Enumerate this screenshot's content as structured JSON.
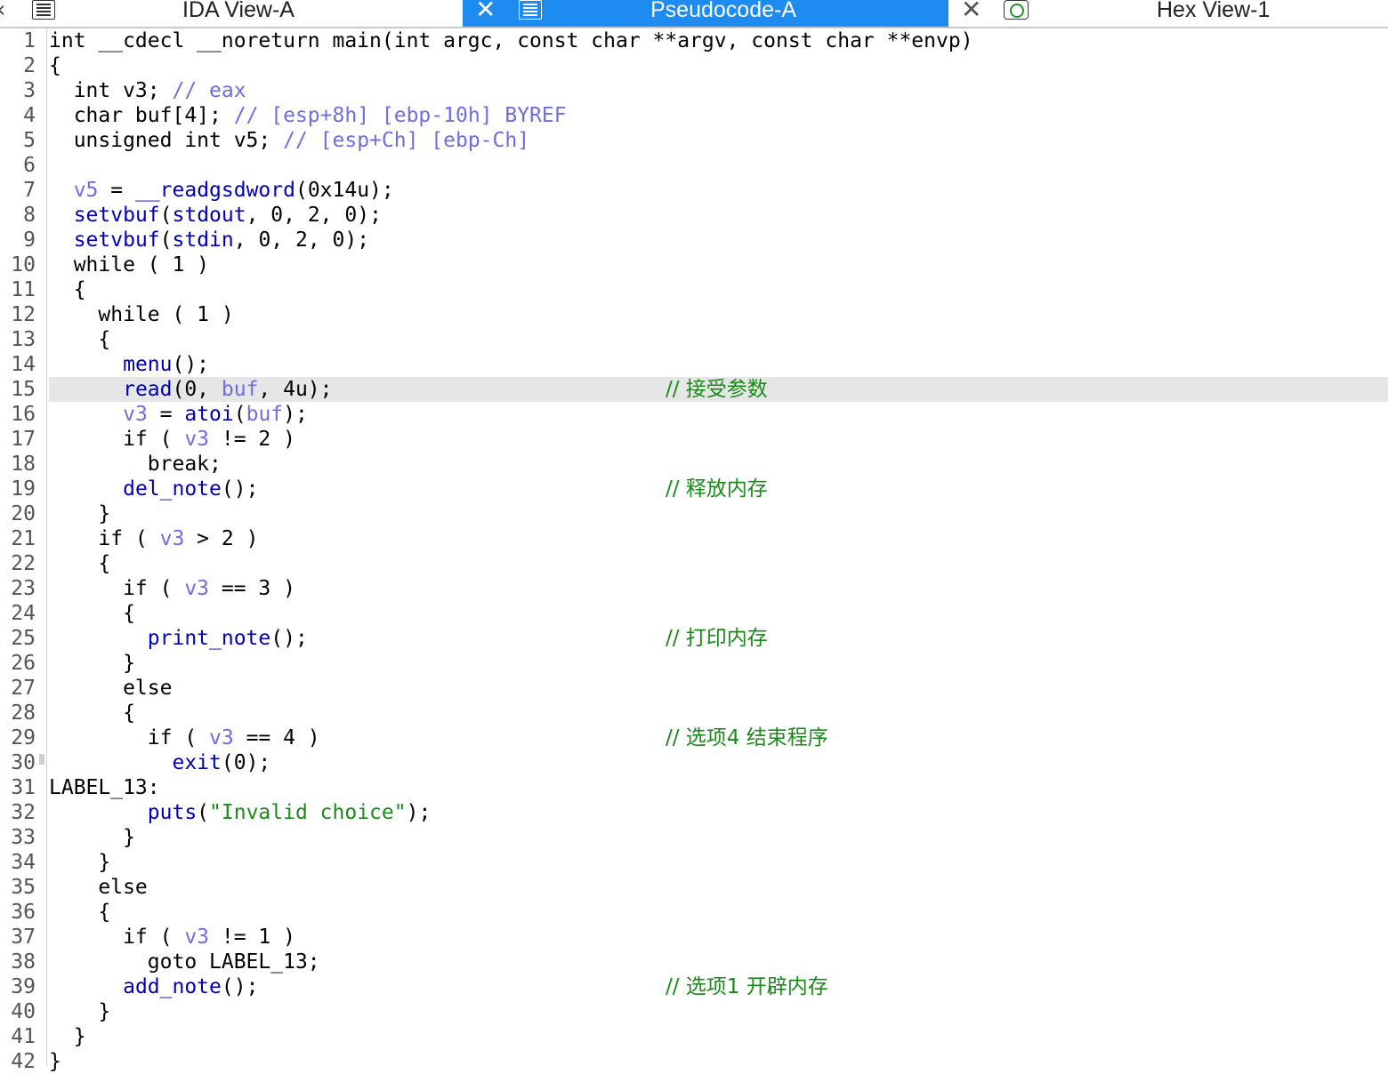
{
  "tabs": {
    "ida": {
      "label": "IDA View-A"
    },
    "pseudo": {
      "label": "Pseudocode-A"
    },
    "hex": {
      "label": "Hex View-1"
    },
    "close_glyph": "✕",
    "back_glyph": "‹"
  },
  "lines": [
    {
      "n": "1",
      "segs": [
        [
          "",
          "int __cdecl __noreturn main(int argc, const char **argv, const char **envp)"
        ]
      ]
    },
    {
      "n": "2",
      "segs": [
        [
          "",
          "{"
        ]
      ]
    },
    {
      "n": "3",
      "segs": [
        [
          "",
          "  int v3; "
        ],
        [
          "ann",
          "// eax"
        ]
      ]
    },
    {
      "n": "4",
      "segs": [
        [
          "",
          "  char buf[4]; "
        ],
        [
          "ann",
          "// [esp+8h] [ebp-10h] BYREF"
        ]
      ]
    },
    {
      "n": "5",
      "segs": [
        [
          "",
          "  unsigned int v5; "
        ],
        [
          "ann",
          "// [esp+Ch] [ebp-Ch]"
        ]
      ]
    },
    {
      "n": "6",
      "segs": [
        [
          "",
          ""
        ]
      ]
    },
    {
      "n": "7",
      "segs": [
        [
          "",
          "  "
        ],
        [
          "var",
          "v5"
        ],
        [
          "",
          " = "
        ],
        [
          "fn",
          "__readgsdword"
        ],
        [
          "",
          "(0x14u);"
        ]
      ]
    },
    {
      "n": "8",
      "segs": [
        [
          "",
          "  "
        ],
        [
          "fn",
          "setvbuf"
        ],
        [
          "",
          "("
        ],
        [
          "fn",
          "stdout"
        ],
        [
          "",
          ", 0, 2, 0);"
        ]
      ]
    },
    {
      "n": "9",
      "segs": [
        [
          "",
          "  "
        ],
        [
          "fn",
          "setvbuf"
        ],
        [
          "",
          "("
        ],
        [
          "fn",
          "stdin"
        ],
        [
          "",
          ", 0, 2, 0);"
        ]
      ]
    },
    {
      "n": "10",
      "segs": [
        [
          "",
          "  while ( 1 )"
        ]
      ]
    },
    {
      "n": "11",
      "segs": [
        [
          "",
          "  {"
        ]
      ]
    },
    {
      "n": "12",
      "segs": [
        [
          "",
          "    while ( 1 )"
        ]
      ]
    },
    {
      "n": "13",
      "segs": [
        [
          "",
          "    {"
        ]
      ]
    },
    {
      "n": "14",
      "segs": [
        [
          "",
          "      "
        ],
        [
          "fn",
          "menu"
        ],
        [
          "",
          "();"
        ]
      ]
    },
    {
      "n": "15",
      "hl": true,
      "segs": [
        [
          "",
          "      "
        ],
        [
          "fn",
          "read"
        ],
        [
          "",
          "(0, "
        ],
        [
          "var",
          "buf"
        ],
        [
          "",
          ", 4u);"
        ]
      ],
      "comment": "// 接受参数"
    },
    {
      "n": "16",
      "segs": [
        [
          "",
          "      "
        ],
        [
          "var",
          "v3"
        ],
        [
          "",
          " = "
        ],
        [
          "fn",
          "atoi"
        ],
        [
          "",
          "("
        ],
        [
          "var",
          "buf"
        ],
        [
          "",
          ");"
        ]
      ]
    },
    {
      "n": "17",
      "segs": [
        [
          "",
          "      if ( "
        ],
        [
          "var",
          "v3"
        ],
        [
          "",
          " != 2 )"
        ]
      ]
    },
    {
      "n": "18",
      "segs": [
        [
          "",
          "        break;"
        ]
      ]
    },
    {
      "n": "19",
      "segs": [
        [
          "",
          "      "
        ],
        [
          "fn",
          "del_note"
        ],
        [
          "",
          "();"
        ]
      ],
      "comment": "// 释放内存"
    },
    {
      "n": "20",
      "segs": [
        [
          "",
          "    }"
        ]
      ]
    },
    {
      "n": "21",
      "segs": [
        [
          "",
          "    if ( "
        ],
        [
          "var",
          "v3"
        ],
        [
          "",
          " > 2 )"
        ]
      ]
    },
    {
      "n": "22",
      "segs": [
        [
          "",
          "    {"
        ]
      ]
    },
    {
      "n": "23",
      "segs": [
        [
          "",
          "      if ( "
        ],
        [
          "var",
          "v3"
        ],
        [
          "",
          " == 3 )"
        ]
      ]
    },
    {
      "n": "24",
      "segs": [
        [
          "",
          "      {"
        ]
      ]
    },
    {
      "n": "25",
      "segs": [
        [
          "",
          "        "
        ],
        [
          "fn",
          "print_note"
        ],
        [
          "",
          "();"
        ]
      ],
      "comment": "// 打印内存"
    },
    {
      "n": "26",
      "segs": [
        [
          "",
          "      }"
        ]
      ]
    },
    {
      "n": "27",
      "segs": [
        [
          "",
          "      else"
        ]
      ]
    },
    {
      "n": "28",
      "segs": [
        [
          "",
          "      {"
        ]
      ]
    },
    {
      "n": "29",
      "segs": [
        [
          "",
          "        if ( "
        ],
        [
          "var",
          "v3"
        ],
        [
          "",
          " == 4 )"
        ]
      ],
      "comment": "// 选项4 结束程序"
    },
    {
      "n": "30",
      "segs": [
        [
          "",
          "          "
        ],
        [
          "fn",
          "exit"
        ],
        [
          "",
          "(0);"
        ]
      ]
    },
    {
      "n": "31",
      "segs": [
        [
          "",
          "LABEL_13:"
        ]
      ]
    },
    {
      "n": "32",
      "segs": [
        [
          "",
          "        "
        ],
        [
          "fn",
          "puts"
        ],
        [
          "",
          "("
        ],
        [
          "str",
          "\"Invalid choice\""
        ],
        [
          "",
          ");"
        ]
      ]
    },
    {
      "n": "33",
      "segs": [
        [
          "",
          "      }"
        ]
      ]
    },
    {
      "n": "34",
      "segs": [
        [
          "",
          "    }"
        ]
      ]
    },
    {
      "n": "35",
      "segs": [
        [
          "",
          "    else"
        ]
      ]
    },
    {
      "n": "36",
      "segs": [
        [
          "",
          "    {"
        ]
      ]
    },
    {
      "n": "37",
      "segs": [
        [
          "",
          "      if ( "
        ],
        [
          "var",
          "v3"
        ],
        [
          "",
          " != 1 )"
        ]
      ]
    },
    {
      "n": "38",
      "segs": [
        [
          "",
          "        goto LABEL_13;"
        ]
      ]
    },
    {
      "n": "39",
      "segs": [
        [
          "",
          "      "
        ],
        [
          "fn",
          "add_note"
        ],
        [
          "",
          "();"
        ]
      ],
      "comment": "// 选项1 开辟内存"
    },
    {
      "n": "40",
      "segs": [
        [
          "",
          "    }"
        ]
      ]
    },
    {
      "n": "41",
      "segs": [
        [
          "",
          "  }"
        ]
      ]
    },
    {
      "n": "42",
      "segs": [
        [
          "",
          "}"
        ]
      ]
    }
  ]
}
